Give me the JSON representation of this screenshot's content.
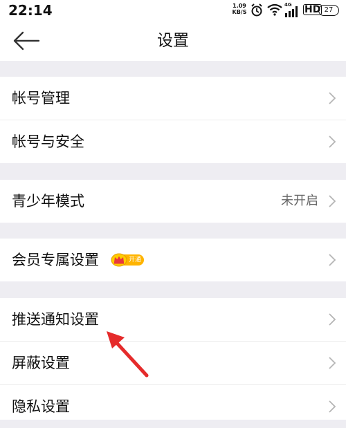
{
  "status_bar": {
    "time": "22:14",
    "net_speed_value": "1.09",
    "net_speed_unit": "KB/S",
    "signal_label": "4G",
    "hd_label": "HD",
    "battery": "27"
  },
  "header": {
    "title": "设置"
  },
  "settings": {
    "account_management": "帐号管理",
    "account_security": "帐号与安全",
    "youth_mode": "青少年模式",
    "youth_mode_status": "未开启",
    "member_settings": "会员专属设置",
    "member_badge": "开通",
    "push_settings": "推送通知设置",
    "block_settings": "屏蔽设置",
    "privacy_settings": "隐私设置"
  },
  "colors": {
    "background": "#eeedf2",
    "row": "#ffffff",
    "chevron": "#b5b5b5",
    "annotation_arrow": "#e52b2b",
    "badge": "#ffb400"
  }
}
